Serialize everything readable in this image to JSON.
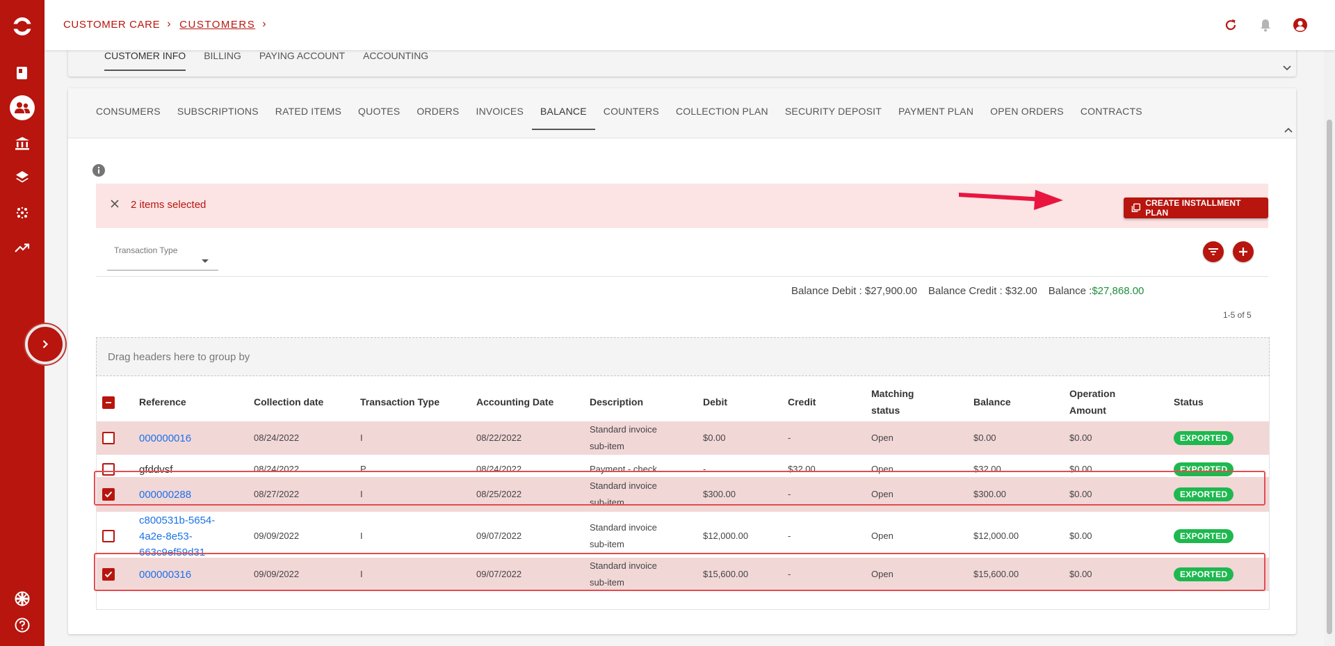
{
  "breadcrumb": {
    "root": "CUSTOMER CARE",
    "current": "CUSTOMERS"
  },
  "colors": {
    "brand": "#b7150e",
    "success": "#1eb84f",
    "link": "#1a73e8",
    "selection_bg": "#fce4e4",
    "highlight": "#e34b50"
  },
  "top_tabs": [
    "CUSTOMER INFO",
    "BILLING",
    "PAYING ACCOUNT",
    "ACCOUNTING"
  ],
  "tabs": [
    "CONSUMERS",
    "SUBSCRIPTIONS",
    "RATED ITEMS",
    "QUOTES",
    "ORDERS",
    "INVOICES",
    "BALANCE",
    "COUNTERS",
    "COLLECTION PLAN",
    "SECURITY DEPOSIT",
    "PAYMENT PLAN",
    "OPEN ORDERS",
    "CONTRACTS"
  ],
  "active_tab": "BALANCE",
  "selection": {
    "text": "2 items selected",
    "button": "CREATE INSTALLMENT PLAN"
  },
  "filter": {
    "transaction_type_label": "Transaction Type"
  },
  "balances": {
    "debit_label": "Balance Debit :",
    "debit_value": "$27,900.00",
    "credit_label": "Balance Credit :",
    "credit_value": "$32.00",
    "balance_label": "Balance :",
    "balance_value": "$27,868.00"
  },
  "pager": "1-5 of 5",
  "grid": {
    "group_hint": "Drag headers here to group by",
    "headers": {
      "reference": "Reference",
      "collection_date": "Collection date",
      "transaction_type": "Transaction Type",
      "accounting_date": "Accounting Date",
      "description": "Description",
      "debit": "Debit",
      "credit": "Credit",
      "matching_1": "Matching",
      "matching_2": "status",
      "balance": "Balance",
      "operation_1": "Operation",
      "operation_2": "Amount",
      "status": "Status"
    },
    "rows": [
      {
        "checked": false,
        "link": true,
        "reference": [
          "000000016"
        ],
        "collection_date": "08/24/2022",
        "transaction_type": "I",
        "accounting_date": "08/22/2022",
        "description": [
          "Standard invoice",
          "sub-item"
        ],
        "debit": "$0.00",
        "credit": "-",
        "matching_status": "Open",
        "balance": "$0.00",
        "operation_amount": "$0.00",
        "status": "EXPORTED"
      },
      {
        "checked": false,
        "link": false,
        "reference": [
          "gfddvsf"
        ],
        "collection_date": "08/24/2022",
        "transaction_type": "P",
        "accounting_date": "08/24/2022",
        "description": [
          "Payment - check"
        ],
        "debit": "-",
        "credit": "$32.00",
        "matching_status": "Open",
        "balance": "$32.00",
        "operation_amount": "$0.00",
        "status": "EXPORTED"
      },
      {
        "checked": true,
        "link": true,
        "reference": [
          "000000288"
        ],
        "collection_date": "08/27/2022",
        "transaction_type": "I",
        "accounting_date": "08/25/2022",
        "description": [
          "Standard invoice",
          "sub-item"
        ],
        "debit": "$300.00",
        "credit": "-",
        "matching_status": "Open",
        "balance": "$300.00",
        "operation_amount": "$0.00",
        "status": "EXPORTED"
      },
      {
        "checked": false,
        "link": true,
        "reference": [
          "c800531b-5654-",
          "4a2e-8e53-",
          "663c9ef59d31"
        ],
        "collection_date": "09/09/2022",
        "transaction_type": "I",
        "accounting_date": "09/07/2022",
        "description": [
          "Standard invoice",
          "sub-item"
        ],
        "debit": "$12,000.00",
        "credit": "-",
        "matching_status": "Open",
        "balance": "$12,000.00",
        "operation_amount": "$0.00",
        "status": "EXPORTED"
      },
      {
        "checked": true,
        "link": true,
        "reference": [
          "000000316"
        ],
        "collection_date": "09/09/2022",
        "transaction_type": "I",
        "accounting_date": "09/07/2022",
        "description": [
          "Standard invoice",
          "sub-item"
        ],
        "debit": "$15,600.00",
        "credit": "-",
        "matching_status": "Open",
        "balance": "$15,600.00",
        "operation_amount": "$0.00",
        "status": "EXPORTED"
      }
    ]
  }
}
